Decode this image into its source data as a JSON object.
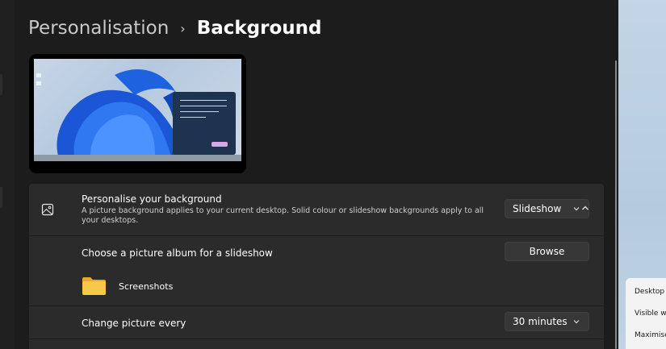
{
  "breadcrumb": {
    "parent": "Personalisation",
    "separator": "›",
    "current": "Background"
  },
  "background_section": {
    "icon": "image-icon",
    "title": "Personalise your background",
    "description": "A picture background applies to your current desktop. Solid colour or slideshow backgrounds apply to all your desktops.",
    "selected_option": "Slideshow",
    "expanded": true
  },
  "album": {
    "label": "Choose a picture album for a slideshow",
    "browse_label": "Browse",
    "folder_icon": "folder-icon",
    "folder_name": "Screenshots"
  },
  "change_picture": {
    "label": "Change picture every",
    "selected_option": "30 minutes"
  },
  "right_menu": {
    "items": [
      "Desktop",
      "Visible wi",
      "Maximise"
    ]
  },
  "colors": {
    "accent": "#0067c0",
    "card": "#2b2b2b",
    "background": "#202020"
  }
}
